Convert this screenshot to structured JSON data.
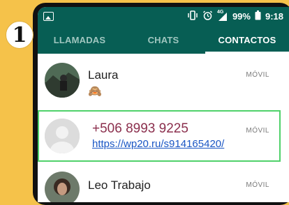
{
  "step_badge": "1",
  "status_bar": {
    "battery": "99%",
    "time": "9:18",
    "signal_label": "4G"
  },
  "tabs": [
    {
      "label": "LLAMADAS"
    },
    {
      "label": "CHATS"
    },
    {
      "label": "CONTACTOS"
    }
  ],
  "contacts": [
    {
      "name": "Laura",
      "type": "MÓVIL",
      "status": "🙈"
    },
    {
      "name": "+506 8993 9225",
      "type": "MÓVIL",
      "link": "https://wp20.ru/s914165420/"
    },
    {
      "name": "Leo Trabajo",
      "type": "MÓVIL"
    }
  ],
  "colors": {
    "header": "#075e54",
    "highlight": "#4fd16a",
    "link": "#1a56c4"
  }
}
